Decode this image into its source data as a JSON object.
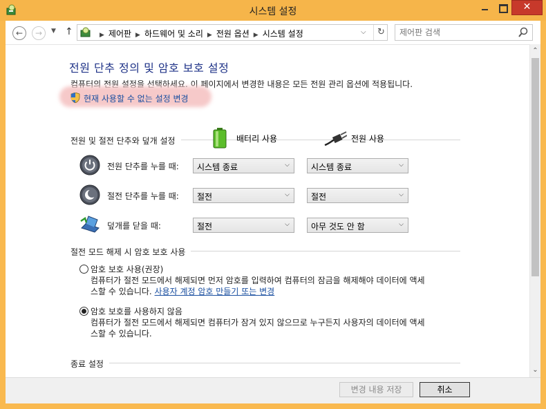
{
  "window": {
    "title": "시스템 설정",
    "close_glyph": "✕"
  },
  "nav": {
    "back_glyph": "←",
    "forward_glyph": "→",
    "recent_glyph": "▼",
    "up_glyph": "↑"
  },
  "address": {
    "crumbs": [
      "제어판",
      "하드웨어 및 소리",
      "전원 옵션",
      "시스템 설정"
    ],
    "separator": "▶",
    "dropdown_glyph": "⌵",
    "refresh_glyph": "↻"
  },
  "search": {
    "placeholder": "제어판 검색"
  },
  "page": {
    "title": "전원 단추 정의 및 암호 보호 설정",
    "description": "컴퓨터의 전원 설정을 선택하세요. 이 페이지에서 변경한 내용은 모든 전원 관리 옵션에 적용됩니다.",
    "change_link": "현재 사용할 수 없는 설정 변경"
  },
  "buttons_section": {
    "label": "전원 및 절전 단추와 덮개 설정",
    "col_battery": "배터리 사용",
    "col_plugged": "전원 사용",
    "rows": [
      {
        "label": "전원 단추를 누를 때:",
        "battery": "시스템 종료",
        "plugged": "시스템 종료"
      },
      {
        "label": "절전 단추를 누를 때:",
        "battery": "절전",
        "plugged": "절전"
      },
      {
        "label": "덮개를 닫을 때:",
        "battery": "절전",
        "plugged": "아무 것도 안 함"
      }
    ],
    "arrow_glyph": "⌵"
  },
  "password_section": {
    "label": "절전 모드 해제 시 암호 보호 사용",
    "options": [
      {
        "label": "암호 보호 사용(권장)",
        "desc_line1": "컴퓨터가 절전 모드에서 해제되면 먼저 암호를 입력하여 컴퓨터의 잠금을 해제해야 데이터에 액세",
        "desc_line2_prefix": "스할 수 있습니다. ",
        "desc_link": "사용자 계정 암호 만들기 또는 변경",
        "selected": false
      },
      {
        "label": "암호 보호를 사용하지 않음",
        "desc_line1": "컴퓨터가 절전 모드에서 해제되면 컴퓨터가 잠겨 있지 않으므로 누구든지 사용자의 데이터에 액세",
        "desc_line2": "스할 수 있습니다.",
        "selected": true
      }
    ]
  },
  "shutdown_section": {
    "label": "종료 설정"
  },
  "scrollbar": {
    "up_glyph": "⌃",
    "down_glyph": "⌄"
  },
  "footer": {
    "save_label": "변경 내용 저장",
    "cancel_label": "취소"
  },
  "colors": {
    "frame": "#f9b94f",
    "title_blue": "#1e3287",
    "link_blue": "#1a4fa0",
    "close_red": "#c7392b"
  }
}
